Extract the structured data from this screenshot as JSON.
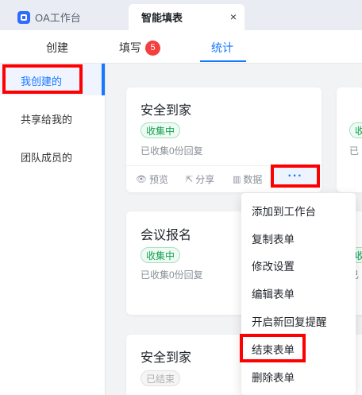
{
  "tabs": {
    "oa_label": "OA工作台",
    "active_label": "智能填表",
    "close_glyph": "×"
  },
  "subnav": {
    "create": "创建",
    "fill": "填写",
    "fill_badge": "5",
    "stats": "统计"
  },
  "sidebar": {
    "items": [
      {
        "label": "我创建的"
      },
      {
        "label": "共享给我的"
      },
      {
        "label": "团队成员的"
      }
    ]
  },
  "cards": [
    {
      "title": "安全到家",
      "status": "收集中",
      "collected": "已收集0份回复",
      "actions": {
        "preview": "预览",
        "share": "分享",
        "data": "数据",
        "more": "···"
      }
    },
    {
      "title": "会议报名",
      "status": "收集中",
      "collected": "已收集0份回复"
    },
    {
      "title": "安全到家",
      "status": "已结束"
    }
  ],
  "partial_cards": {
    "top_status": "收",
    "top_collected": "已",
    "mid_title": "旺",
    "mid_status": "收",
    "mid_collected": "已",
    "bot_title": "方"
  },
  "menu": {
    "items": [
      "添加到工作台",
      "复制表单",
      "修改设置",
      "编辑表单",
      "开启新回复提醒",
      "结束表单",
      "删除表单"
    ]
  },
  "colors": {
    "accent": "#1677ff",
    "badge": "#f53f3f",
    "status_green": "#12a150",
    "highlight": "#ff0000"
  }
}
